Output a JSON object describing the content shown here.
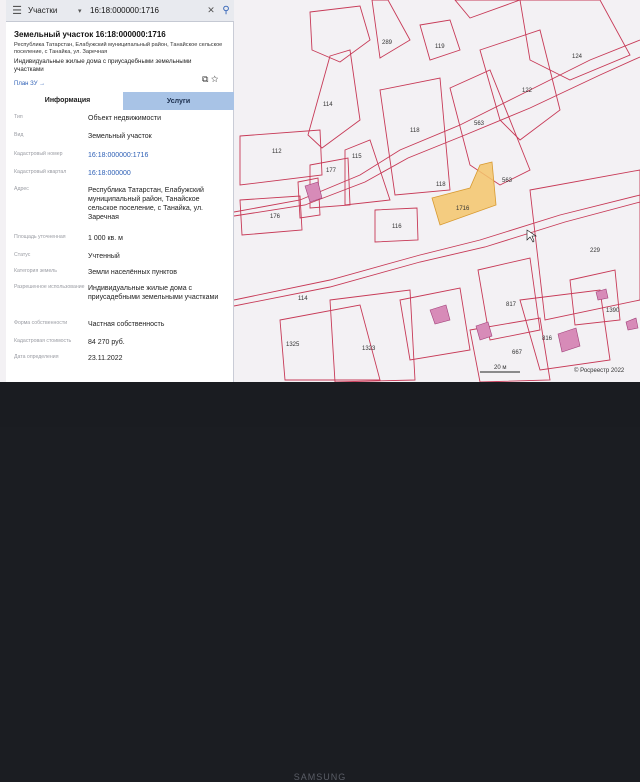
{
  "search": {
    "layer": "Участки",
    "query": "16:18:000000:1716"
  },
  "card": {
    "title": "Земельный участок 16:18:000000:1716",
    "address": "Республика Татарстан, Елабужский муниципальный район, Танайское сельское поселение, с Танайка, ул. Заречная",
    "usage": "Индивидуальные жилые дома с приусадебными земельными участками",
    "plan_link": "План ЗУ →"
  },
  "tabs": {
    "info": "Информация",
    "services": "Услуги"
  },
  "properties": [
    {
      "label": "Тип",
      "value": "Объект недвижимости"
    },
    {
      "label": "Вид",
      "value": "Земельный участок"
    },
    {
      "label": "Кадастровый номер",
      "value": "16:18:000000:1716"
    },
    {
      "label": "Кадастровый квартал",
      "value": "16:18:000000"
    },
    {
      "label": "Адрес",
      "value": "Республика Татарстан, Елабужский муниципальный район, Танайское сельское поселение, с Танайка, ул. Заречная"
    },
    {
      "label": "Площадь уточненная",
      "value": "1 000 кв. м"
    },
    {
      "label": "Статус",
      "value": "Учтенный"
    },
    {
      "label": "Категория земель",
      "value": "Земли населённых пунктов"
    },
    {
      "label": "Разрешенное использование",
      "value": "Индивидуальные жилые дома с приусадебными земельными участками"
    },
    {
      "label": "Форма собственности",
      "value": "Частная собственность"
    },
    {
      "label": "Кадастровая стоимость",
      "value": "84 270 руб."
    },
    {
      "label": "Дата определения",
      "value": "23.11.2022"
    }
  ],
  "map": {
    "parcels": [
      "289",
      "119",
      "124",
      "114",
      "122",
      "118",
      "563",
      "112",
      "115",
      "177",
      "176",
      "118",
      "1716",
      "563",
      "116",
      "229",
      "114",
      "817",
      "1390",
      "1325",
      "1323",
      "667",
      "816"
    ],
    "scale": "20 м",
    "attribution": "© Росреестр 2022"
  },
  "bezel": {
    "brand": "SAMSUNG"
  },
  "colors": {
    "boundary": "#c73a57",
    "selected": "#f3c56b",
    "building": "#d78bb8",
    "tab_active": "#a8c3e6",
    "link": "#2d5fb5"
  }
}
